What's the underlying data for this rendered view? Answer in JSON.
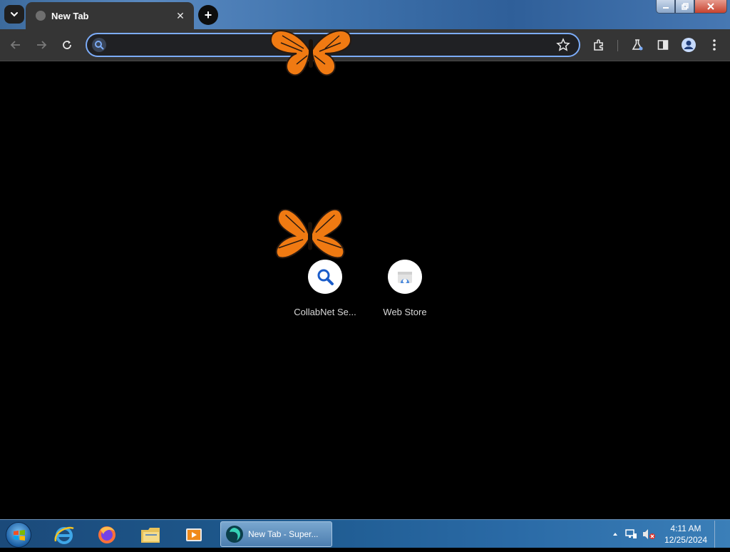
{
  "browser": {
    "tab": {
      "title": "New Tab",
      "close_glyph": "✕"
    },
    "newtab_glyph": "+",
    "window_controls": {
      "minimize": "▁",
      "maximize": "❐",
      "close": "✕"
    },
    "omnibox": {
      "value": "",
      "placeholder": ""
    },
    "toolbar_icons": [
      "back-arrow-icon",
      "forward-arrow-icon",
      "reload-icon",
      "star-icon",
      "extensions-icon",
      "labs-flask-icon",
      "side-panel-icon",
      "profile-icon",
      "menu-icon"
    ]
  },
  "shortcuts": [
    {
      "label": "CollabNet Se...",
      "icon": "search-icon"
    },
    {
      "label": "Web Store",
      "icon": "web-store-icon"
    }
  ],
  "taskbar": {
    "active_window_label": "New Tab - Super...",
    "apps": [
      "internet-explorer-icon",
      "firefox-icon",
      "file-explorer-icon",
      "media-player-icon"
    ],
    "clock_time": "4:11 AM",
    "clock_date": "12/25/2024"
  },
  "colors": {
    "accent": "#7cacf8",
    "page_background": "#000000",
    "toolbar": "#353535"
  }
}
